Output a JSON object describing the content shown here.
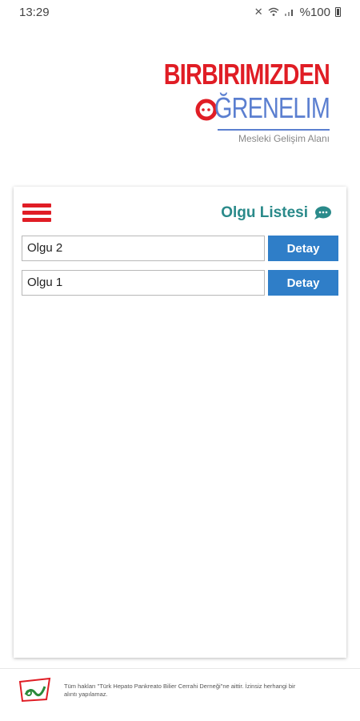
{
  "status_bar": {
    "time": "13:29",
    "battery": "%100",
    "icons": [
      "mute-icon",
      "wifi-icon",
      "signal-icon",
      "battery-icon"
    ]
  },
  "logo": {
    "line1": "BIRBIRIMIZDEN",
    "line2": "ĞRENELIM",
    "subtitle": "Mesleki Gelişim Alanı"
  },
  "card": {
    "title": "Olgu Listesi",
    "menu_icon": "hamburger-menu-icon",
    "items": [
      {
        "label": "Olgu 2",
        "button": "Detay"
      },
      {
        "label": "Olgu 1",
        "button": "Detay"
      }
    ]
  },
  "footer": {
    "text": "Tüm hakları \"Türk Hepato Pankreato Bilier Cerrahi Derneği\"ne aittir. İzinsiz herhangi bir alıntı yapılamaz."
  },
  "colors": {
    "brand_red": "#e01d25",
    "brand_blue": "#5b7fd0",
    "title_teal": "#2a8a8a",
    "button_blue": "#2f7ec8"
  }
}
